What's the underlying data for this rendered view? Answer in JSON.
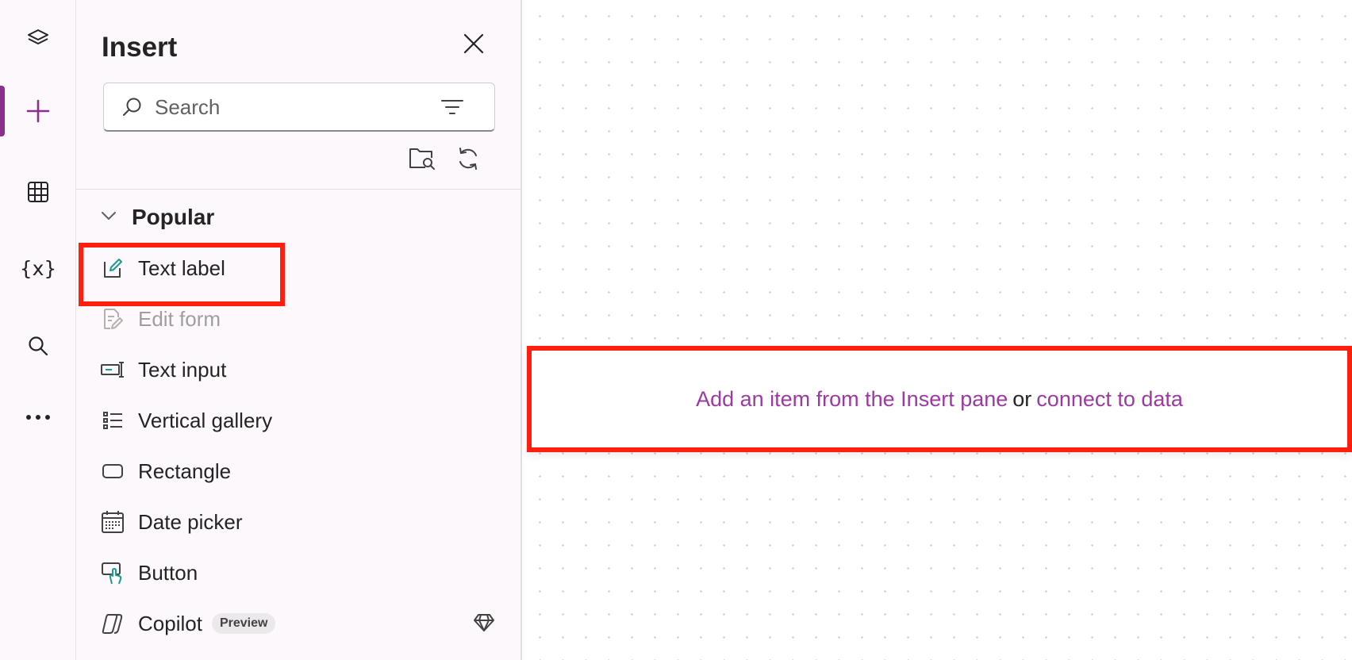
{
  "rail": {
    "items": [
      {
        "name": "tree-view",
        "icon": "layers-icon"
      },
      {
        "name": "insert",
        "icon": "plus-icon",
        "active": true
      },
      {
        "name": "data",
        "icon": "table-icon"
      },
      {
        "name": "variables",
        "icon": "variables-icon",
        "label": "{x}"
      },
      {
        "name": "search",
        "icon": "search-icon"
      },
      {
        "name": "more",
        "icon": "more-icon"
      }
    ],
    "accent_color": "#8a2f8c"
  },
  "pane": {
    "title": "Insert",
    "search": {
      "placeholder": "Search",
      "value": ""
    },
    "section": {
      "title": "Popular",
      "expanded": true
    },
    "items": [
      {
        "label": "Text label",
        "icon": "edit-pencil-icon",
        "disabled": false
      },
      {
        "label": "Edit form",
        "icon": "form-edit-icon",
        "disabled": true
      },
      {
        "label": "Text input",
        "icon": "text-input-icon",
        "disabled": false
      },
      {
        "label": "Vertical gallery",
        "icon": "gallery-list-icon",
        "disabled": false
      },
      {
        "label": "Rectangle",
        "icon": "rectangle-icon",
        "disabled": false
      },
      {
        "label": "Date picker",
        "icon": "calendar-icon",
        "disabled": false
      },
      {
        "label": "Button",
        "icon": "button-cursor-icon",
        "disabled": false
      },
      {
        "label": "Copilot",
        "icon": "copilot-icon",
        "badge": "Preview",
        "disabled": false
      }
    ]
  },
  "canvas": {
    "link_insert": "Add an item from the Insert pane",
    "or_text": "or",
    "link_data": "connect to data",
    "link_color": "#9b3aa0",
    "highlight_color": "#ff1f0f"
  }
}
